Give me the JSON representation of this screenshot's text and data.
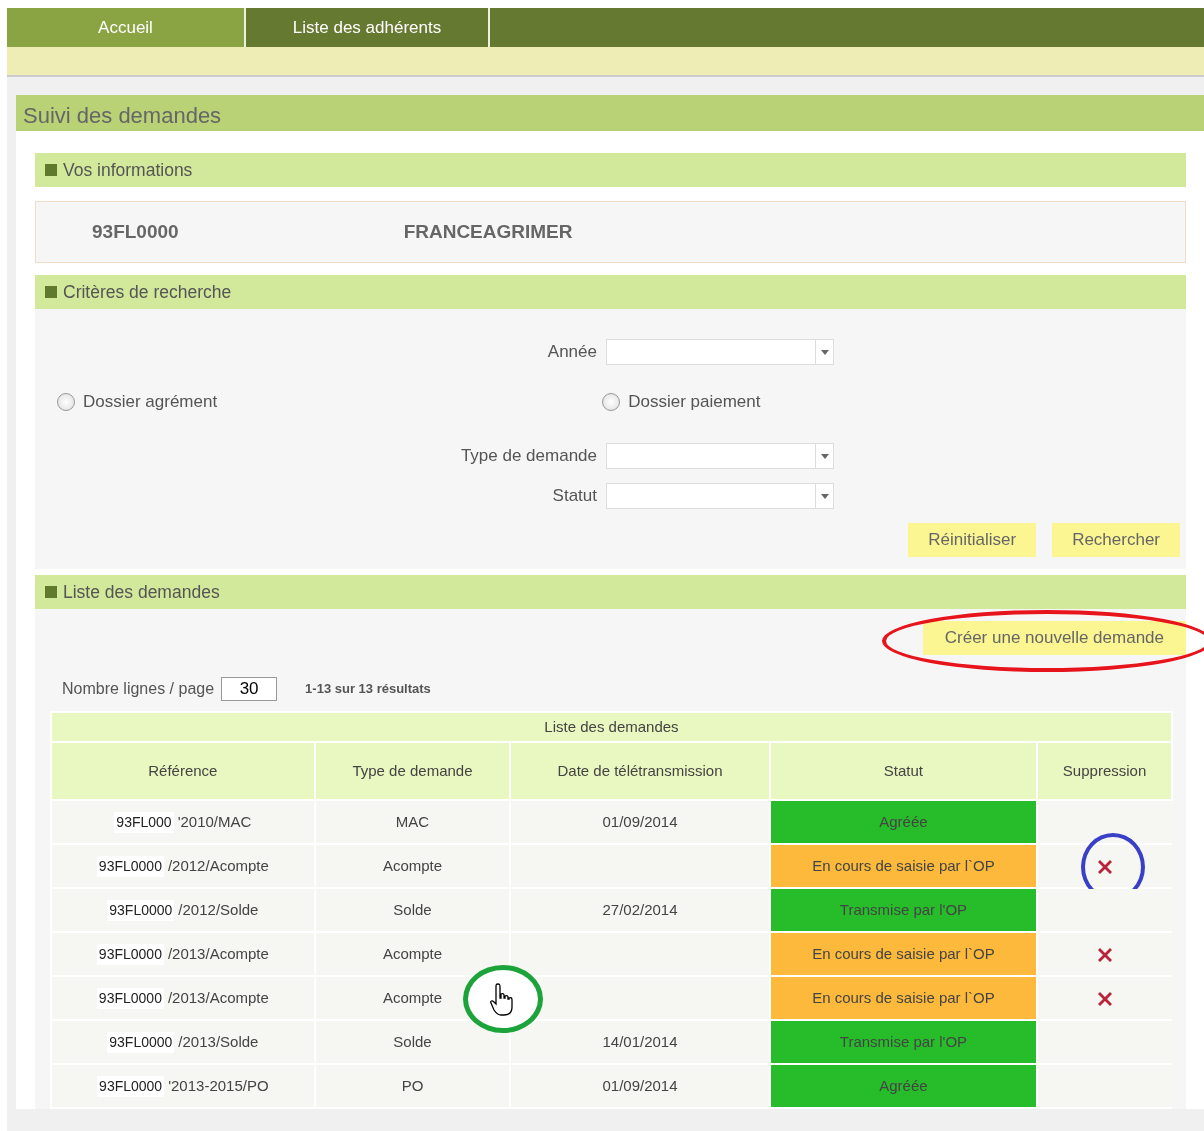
{
  "nav_tabs": [
    {
      "label": "Accueil",
      "selected": true
    },
    {
      "label": "Liste des adhérents",
      "selected": false
    }
  ],
  "page_title": "Suivi des demandes",
  "info_section": {
    "title": "Vos informations",
    "code": "93FL0000",
    "name": "FRANCEAGRIMER"
  },
  "criteria_section": {
    "title": "Critères de recherche",
    "year_field": {
      "label": "Année"
    },
    "radios": [
      {
        "label": "Dossier agrément",
        "checked": false
      },
      {
        "label": "Dossier paiement",
        "checked": false
      }
    ],
    "fields": [
      {
        "label": "Type de demande"
      },
      {
        "label": "Statut"
      }
    ],
    "buttons": [
      "Réinitialiser",
      "Rechercher"
    ]
  },
  "list_section": {
    "title": "Liste des demandes",
    "create_button": {
      "label": "Créer une nouvelle demande",
      "circled": true
    },
    "rows_per_page_label": "Nombre lignes / page",
    "rows_per_page": "30",
    "result_count": "1-13 sur 13 résultats",
    "table": {
      "caption": "Liste des demandes",
      "columns": [
        "Référence",
        "Type de demande",
        "Date de télétransmission",
        "Statut",
        "Suppression"
      ],
      "rows": [
        {
          "ref_prefix": "93FL000",
          "ref_suffix": "'2010/MAC",
          "type": "MAC",
          "date": "01/09/2014",
          "status": "Agréée",
          "color": "#27bd2a",
          "deletable": false,
          "delete_circled": false,
          "cursor_circled": false
        },
        {
          "ref_prefix": "93FL0000",
          "ref_suffix": "/2012/Acompte",
          "type": "Acompte",
          "status": "En cours de saisie par l`OP",
          "color": "#fdb93c",
          "deletable": true,
          "delete_circled": true,
          "cursor_circled": false
        },
        {
          "ref_prefix": "93FL0000",
          "ref_suffix": "/2012/Solde",
          "type": "Solde",
          "date": "27/02/2014",
          "status": "Transmise par l'OP",
          "color": "#27bd2a",
          "deletable": false,
          "delete_circled": false,
          "cursor_circled": false
        },
        {
          "ref_prefix": "93FL0000",
          "ref_suffix": "/2013/Acompte",
          "type": "Acompte",
          "status": "En cours de saisie par l`OP",
          "color": "#fdb93c",
          "deletable": true,
          "delete_circled": false,
          "cursor_circled": false
        },
        {
          "ref_prefix": "93FL0000",
          "ref_suffix": "/2013/Acompte",
          "type": "Acompte",
          "status": "En cours de saisie par l`OP",
          "color": "#fdb93c",
          "deletable": true,
          "delete_circled": false,
          "cursor_circled": true
        },
        {
          "ref_prefix": "93FL0000",
          "ref_suffix": "/2013/Solde",
          "type": "Solde",
          "date": "14/01/2014",
          "status": "Transmise par l'OP",
          "color": "#27bd2a",
          "deletable": false,
          "delete_circled": false,
          "cursor_circled": false
        },
        {
          "ref_prefix": "93FL0000",
          "ref_suffix": "'2013-2015/PO",
          "type": "PO",
          "date": "01/09/2014",
          "status": "Agréée",
          "color": "#27bd2a",
          "deletable": false,
          "delete_circled": false,
          "cursor_circled": false
        }
      ]
    }
  }
}
